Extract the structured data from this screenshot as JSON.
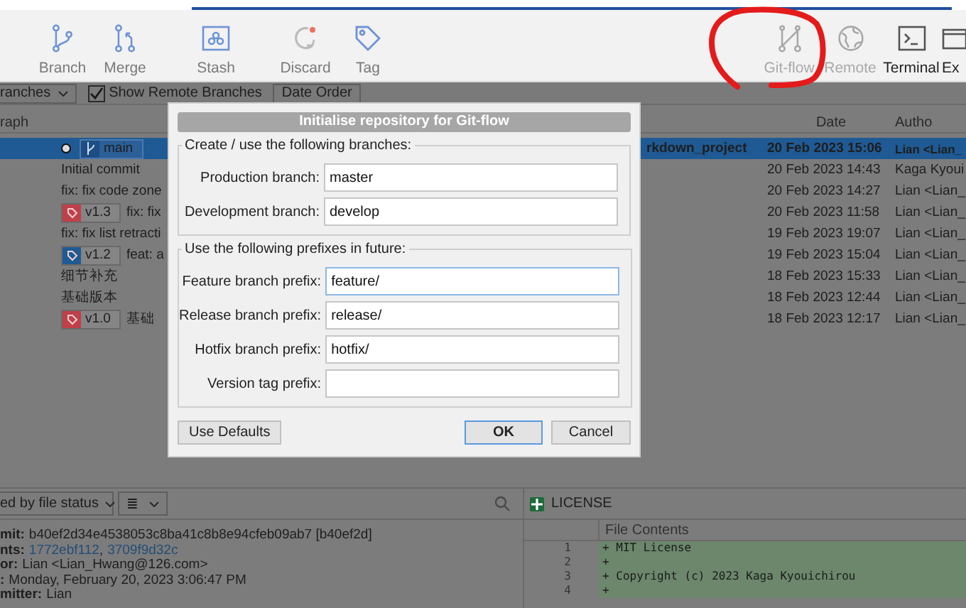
{
  "toolbar": {
    "left": [
      {
        "label": "Branch",
        "disabled": false
      },
      {
        "label": "Merge",
        "disabled": false
      },
      {
        "label": "Stash",
        "disabled": false
      },
      {
        "label": "Discard",
        "disabled": false
      },
      {
        "label": "Tag",
        "disabled": false
      }
    ],
    "right": [
      {
        "label": "Git-flow",
        "disabled": true
      },
      {
        "label": "Remote",
        "disabled": true
      },
      {
        "label": "Terminal",
        "disabled": false
      },
      {
        "label": "Ex",
        "disabled": false
      }
    ]
  },
  "filter_bar": {
    "branches_dropdown": "ranches",
    "show_remote": {
      "label": "Show Remote Branches",
      "checked": true
    },
    "order_dropdown": "Date Order"
  },
  "history": {
    "columns": [
      "raph",
      "Date",
      "Autho"
    ],
    "rows": [
      {
        "selected": true,
        "badges": [
          {
            "kind": "branch",
            "label": "main"
          }
        ],
        "message_tail": "rkdown_project",
        "date": "20 Feb 2023 15:06",
        "author": "Lian <Lian_"
      },
      {
        "selected": false,
        "message": "Initial commit",
        "date": "20 Feb 2023 14:43",
        "author": "Kaga Kyoui"
      },
      {
        "selected": false,
        "message": "fix: fix code zone",
        "date": "20 Feb 2023 14:27",
        "author": "Lian <Lian_"
      },
      {
        "selected": false,
        "badges": [
          {
            "kind": "tag",
            "label": "v1.3",
            "color": "#c0404a"
          }
        ],
        "message": "fix: fix",
        "date": "20 Feb 2023 11:58",
        "author": "Lian <Lian_"
      },
      {
        "selected": false,
        "message": "fix: fix list retracti",
        "date": "19 Feb 2023 19:07",
        "author": "Lian <Lian_"
      },
      {
        "selected": false,
        "badges": [
          {
            "kind": "tag",
            "label": "v1.2",
            "color": "#1f5a94"
          }
        ],
        "message": "feat: a",
        "date": "19 Feb 2023 15:04",
        "author": "Lian <Lian_"
      },
      {
        "selected": false,
        "message": "细节补充",
        "date": "18 Feb 2023 15:33",
        "author": "Lian <Lian_"
      },
      {
        "selected": false,
        "message": "基础版本",
        "date": "18 Feb 2023 12:44",
        "author": "Lian <Lian_"
      },
      {
        "selected": false,
        "badges": [
          {
            "kind": "tag",
            "label": "v1.0",
            "color": "#c0404a"
          }
        ],
        "message": "基础",
        "date": "18 Feb 2023 12:17",
        "author": "Lian <Lian_"
      }
    ]
  },
  "files_toolbar": {
    "sort_dropdown": "ed by file status",
    "view_dropdown": "≣"
  },
  "commit_details": [
    {
      "label": "mit:",
      "value": "b40ef2d34e4538053c8ba41c8b8e94cfeb09ab7 [b40ef2d]"
    },
    {
      "label": "nts:",
      "links": [
        "1772ebf112",
        "3709f9d32c"
      ],
      "separator": ","
    },
    {
      "label": "or:",
      "value": "Lian <Lian_Hwang@126.com>"
    },
    {
      "label": ":",
      "value": "Monday, February 20, 2023 3:06:47 PM"
    },
    {
      "label": "mitter:",
      "value": "Lian"
    }
  ],
  "file_view": {
    "file_name": "LICENSE",
    "header": "File Contents",
    "lines": [
      {
        "number": "1",
        "text": "+ MIT License"
      },
      {
        "number": "2",
        "text": "+"
      },
      {
        "number": "3",
        "text": "+ Copyright (c) 2023 Kaga Kyouichirou"
      },
      {
        "number": "4",
        "text": "+"
      }
    ]
  },
  "dialog": {
    "title": "Initialise repository for Git-flow",
    "groups": [
      {
        "legend": "Create / use the following branches:",
        "fields": [
          {
            "label": "Production branch:",
            "value": "master",
            "focused": false
          },
          {
            "label": "Development branch:",
            "value": "develop",
            "focused": false
          }
        ]
      },
      {
        "legend": "Use the following prefixes in future:",
        "fields": [
          {
            "label": "Feature branch prefix:",
            "value": "feature/",
            "focused": true
          },
          {
            "label": "Release branch prefix:",
            "value": "release/",
            "focused": false
          },
          {
            "label": "Hotfix branch prefix:",
            "value": "hotfix/",
            "focused": false
          },
          {
            "label": "Version tag prefix:",
            "focused": false
          }
        ]
      }
    ],
    "buttons": [
      {
        "label": "Use Defaults",
        "default": false
      },
      {
        "label": "OK",
        "default": true
      },
      {
        "label": "Cancel",
        "default": false
      }
    ]
  }
}
